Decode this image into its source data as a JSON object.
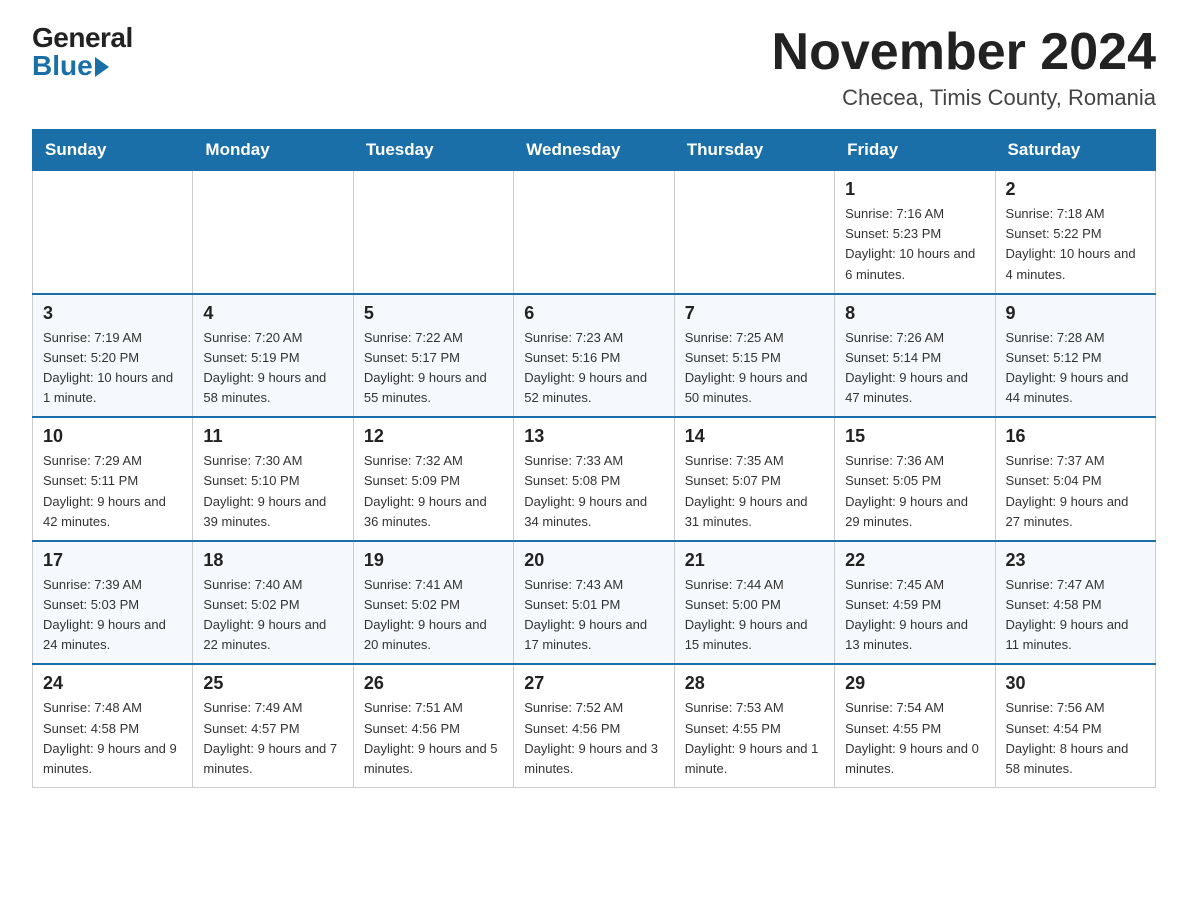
{
  "logo": {
    "general": "General",
    "blue": "Blue"
  },
  "title": "November 2024",
  "subtitle": "Checea, Timis County, Romania",
  "days_of_week": [
    "Sunday",
    "Monday",
    "Tuesday",
    "Wednesday",
    "Thursday",
    "Friday",
    "Saturday"
  ],
  "weeks": [
    [
      {
        "day": "",
        "info": ""
      },
      {
        "day": "",
        "info": ""
      },
      {
        "day": "",
        "info": ""
      },
      {
        "day": "",
        "info": ""
      },
      {
        "day": "",
        "info": ""
      },
      {
        "day": "1",
        "info": "Sunrise: 7:16 AM\nSunset: 5:23 PM\nDaylight: 10 hours and 6 minutes."
      },
      {
        "day": "2",
        "info": "Sunrise: 7:18 AM\nSunset: 5:22 PM\nDaylight: 10 hours and 4 minutes."
      }
    ],
    [
      {
        "day": "3",
        "info": "Sunrise: 7:19 AM\nSunset: 5:20 PM\nDaylight: 10 hours and 1 minute."
      },
      {
        "day": "4",
        "info": "Sunrise: 7:20 AM\nSunset: 5:19 PM\nDaylight: 9 hours and 58 minutes."
      },
      {
        "day": "5",
        "info": "Sunrise: 7:22 AM\nSunset: 5:17 PM\nDaylight: 9 hours and 55 minutes."
      },
      {
        "day": "6",
        "info": "Sunrise: 7:23 AM\nSunset: 5:16 PM\nDaylight: 9 hours and 52 minutes."
      },
      {
        "day": "7",
        "info": "Sunrise: 7:25 AM\nSunset: 5:15 PM\nDaylight: 9 hours and 50 minutes."
      },
      {
        "day": "8",
        "info": "Sunrise: 7:26 AM\nSunset: 5:14 PM\nDaylight: 9 hours and 47 minutes."
      },
      {
        "day": "9",
        "info": "Sunrise: 7:28 AM\nSunset: 5:12 PM\nDaylight: 9 hours and 44 minutes."
      }
    ],
    [
      {
        "day": "10",
        "info": "Sunrise: 7:29 AM\nSunset: 5:11 PM\nDaylight: 9 hours and 42 minutes."
      },
      {
        "day": "11",
        "info": "Sunrise: 7:30 AM\nSunset: 5:10 PM\nDaylight: 9 hours and 39 minutes."
      },
      {
        "day": "12",
        "info": "Sunrise: 7:32 AM\nSunset: 5:09 PM\nDaylight: 9 hours and 36 minutes."
      },
      {
        "day": "13",
        "info": "Sunrise: 7:33 AM\nSunset: 5:08 PM\nDaylight: 9 hours and 34 minutes."
      },
      {
        "day": "14",
        "info": "Sunrise: 7:35 AM\nSunset: 5:07 PM\nDaylight: 9 hours and 31 minutes."
      },
      {
        "day": "15",
        "info": "Sunrise: 7:36 AM\nSunset: 5:05 PM\nDaylight: 9 hours and 29 minutes."
      },
      {
        "day": "16",
        "info": "Sunrise: 7:37 AM\nSunset: 5:04 PM\nDaylight: 9 hours and 27 minutes."
      }
    ],
    [
      {
        "day": "17",
        "info": "Sunrise: 7:39 AM\nSunset: 5:03 PM\nDaylight: 9 hours and 24 minutes."
      },
      {
        "day": "18",
        "info": "Sunrise: 7:40 AM\nSunset: 5:02 PM\nDaylight: 9 hours and 22 minutes."
      },
      {
        "day": "19",
        "info": "Sunrise: 7:41 AM\nSunset: 5:02 PM\nDaylight: 9 hours and 20 minutes."
      },
      {
        "day": "20",
        "info": "Sunrise: 7:43 AM\nSunset: 5:01 PM\nDaylight: 9 hours and 17 minutes."
      },
      {
        "day": "21",
        "info": "Sunrise: 7:44 AM\nSunset: 5:00 PM\nDaylight: 9 hours and 15 minutes."
      },
      {
        "day": "22",
        "info": "Sunrise: 7:45 AM\nSunset: 4:59 PM\nDaylight: 9 hours and 13 minutes."
      },
      {
        "day": "23",
        "info": "Sunrise: 7:47 AM\nSunset: 4:58 PM\nDaylight: 9 hours and 11 minutes."
      }
    ],
    [
      {
        "day": "24",
        "info": "Sunrise: 7:48 AM\nSunset: 4:58 PM\nDaylight: 9 hours and 9 minutes."
      },
      {
        "day": "25",
        "info": "Sunrise: 7:49 AM\nSunset: 4:57 PM\nDaylight: 9 hours and 7 minutes."
      },
      {
        "day": "26",
        "info": "Sunrise: 7:51 AM\nSunset: 4:56 PM\nDaylight: 9 hours and 5 minutes."
      },
      {
        "day": "27",
        "info": "Sunrise: 7:52 AM\nSunset: 4:56 PM\nDaylight: 9 hours and 3 minutes."
      },
      {
        "day": "28",
        "info": "Sunrise: 7:53 AM\nSunset: 4:55 PM\nDaylight: 9 hours and 1 minute."
      },
      {
        "day": "29",
        "info": "Sunrise: 7:54 AM\nSunset: 4:55 PM\nDaylight: 9 hours and 0 minutes."
      },
      {
        "day": "30",
        "info": "Sunrise: 7:56 AM\nSunset: 4:54 PM\nDaylight: 8 hours and 58 minutes."
      }
    ]
  ]
}
